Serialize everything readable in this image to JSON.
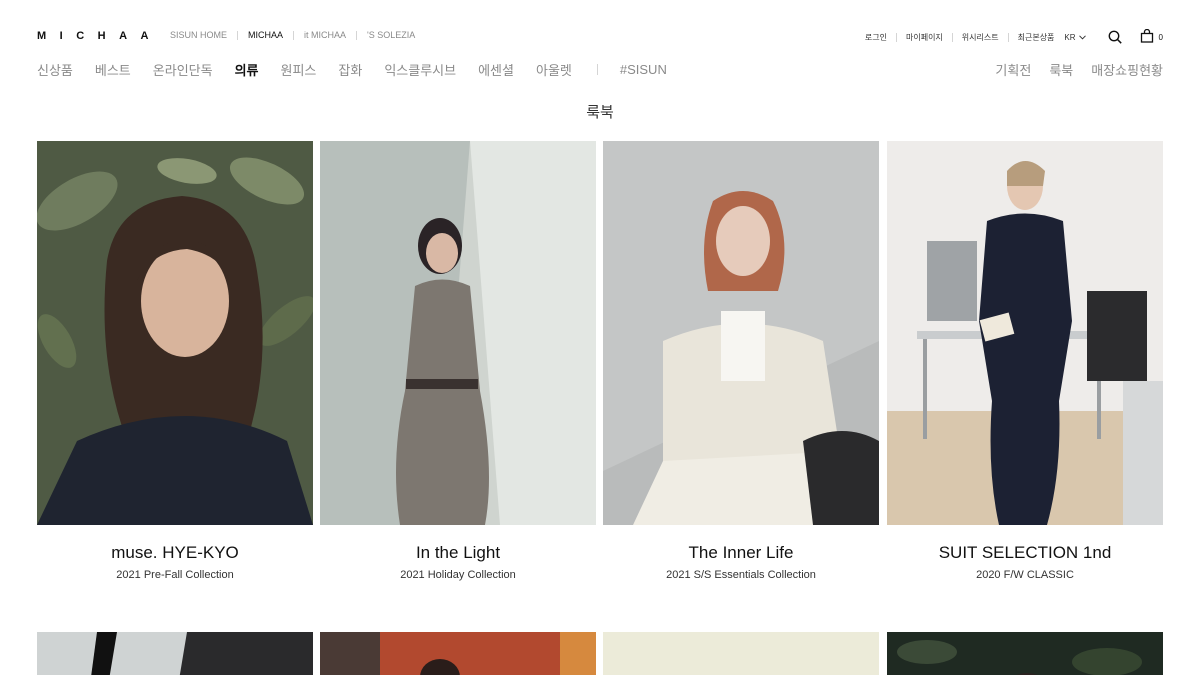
{
  "header": {
    "logo": "MICHAA",
    "brands": [
      {
        "label": "SISUN HOME",
        "active": false
      },
      {
        "label": "MICHAA",
        "active": true
      },
      {
        "label": "it MICHAA",
        "active": false
      },
      {
        "label": "'S SOLEZIA",
        "active": false
      }
    ],
    "util_links": [
      "로그인",
      "마이페이지",
      "위시리스트",
      "최근본상품"
    ],
    "lang": "KR",
    "cart_count": "0",
    "icons": {
      "search": "search-icon",
      "cart": "shopping-bag-icon",
      "lang": "chevron-down-icon"
    }
  },
  "nav": {
    "items": [
      "신상품",
      "베스트",
      "온라인단독",
      "의류",
      "원피스",
      "잡화",
      "익스클루시브",
      "에센셜",
      "아울렛"
    ],
    "active": "의류",
    "special": "#SISUN",
    "right": [
      "기획전",
      "룩북",
      "매장쇼핑현황"
    ]
  },
  "page": {
    "title": "룩북"
  },
  "lookbooks": [
    {
      "title": "muse. HYE-KYO",
      "subtitle": "2021 Pre-Fall Collection"
    },
    {
      "title": "In the Light",
      "subtitle": "2021 Holiday Collection"
    },
    {
      "title": "The Inner Life",
      "subtitle": "2021 S/S Essentials Collection"
    },
    {
      "title": "SUIT SELECTION 1nd",
      "subtitle": "2020 F/W CLASSIC"
    }
  ],
  "colors": {
    "text": "#111111",
    "muted": "#8a8a8a",
    "divider": "#d5d5d5",
    "background": "#ffffff"
  }
}
